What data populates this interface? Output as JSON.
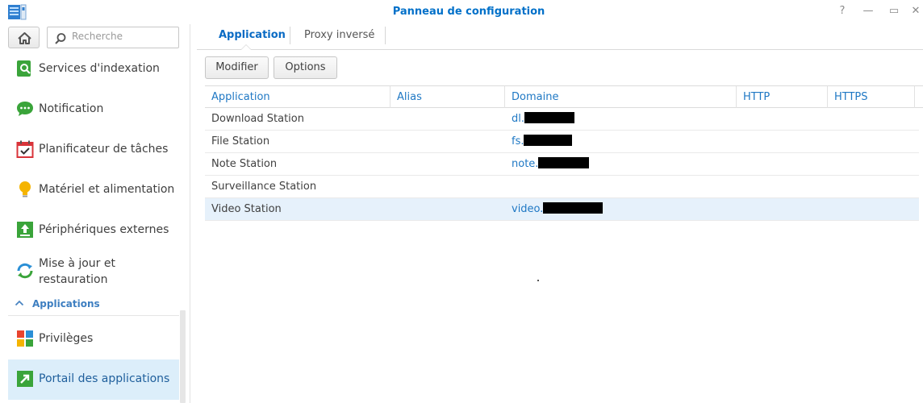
{
  "window": {
    "title": "Panneau de configuration",
    "controls": [
      {
        "name": "help-icon",
        "glyph": "?"
      },
      {
        "name": "minimize-icon",
        "glyph": "—"
      },
      {
        "name": "maximize-icon",
        "glyph": "▭"
      },
      {
        "name": "close-icon",
        "glyph": "✕"
      }
    ]
  },
  "search": {
    "placeholder": "Recherche"
  },
  "sidebar": {
    "items": [
      {
        "label": "Services d'indexation",
        "icon": "indexing-icon"
      },
      {
        "label": "Notification",
        "icon": "notification-icon"
      },
      {
        "label": "Planificateur de tâches",
        "icon": "task-scheduler-icon"
      },
      {
        "label": "Matériel et alimentation",
        "icon": "hardware-power-icon"
      },
      {
        "label": "Périphériques externes",
        "icon": "external-devices-icon"
      },
      {
        "label": "Mise à jour et restauration",
        "icon": "update-restore-icon"
      }
    ],
    "section": "Applications",
    "apps": [
      {
        "label": "Privilèges",
        "icon": "privileges-icon"
      },
      {
        "label": "Portail des applications",
        "icon": "app-portal-icon",
        "active": true
      }
    ]
  },
  "tabs": [
    {
      "label": "Application",
      "active": true
    },
    {
      "label": "Proxy inversé",
      "active": false
    }
  ],
  "toolbar": {
    "modify_label": "Modifier",
    "options_label": "Options"
  },
  "grid": {
    "columns": [
      "Application",
      "Alias",
      "Domaine",
      "HTTP",
      "HTTPS"
    ],
    "rows": [
      {
        "application": "Download Station",
        "alias": "",
        "domain": "dl.",
        "http": "",
        "https": "",
        "redacted": true
      },
      {
        "application": "File Station",
        "alias": "",
        "domain": "fs.",
        "http": "",
        "https": "",
        "redacted": true
      },
      {
        "application": "Note Station",
        "alias": "",
        "domain": "note.",
        "http": "",
        "https": "",
        "redacted": true
      },
      {
        "application": "Surveillance Station",
        "alias": "",
        "domain": "",
        "http": "",
        "https": "",
        "redacted": false
      },
      {
        "application": "Video Station",
        "alias": "",
        "domain": "video.",
        "http": "",
        "https": "",
        "redacted": true,
        "selected": true
      }
    ]
  },
  "colors": {
    "accent": "#0070c9",
    "selected_row": "#e6f1fb",
    "active_nav": "#dceefa"
  }
}
